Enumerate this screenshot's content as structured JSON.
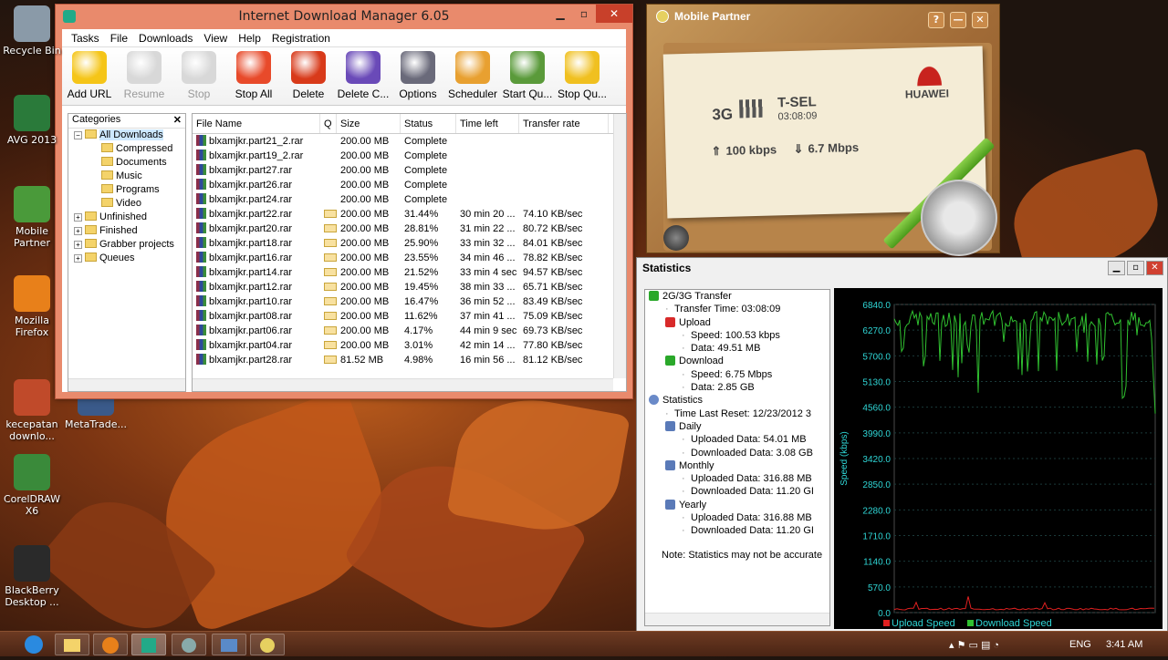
{
  "desktop": {
    "icons": [
      {
        "label": "Recycle Bin",
        "top": 6
      },
      {
        "label": "AVG 2013",
        "top": 104
      },
      {
        "label": "Mobile Partner",
        "top": 204
      },
      {
        "label": "Mozilla Firefox",
        "top": 302
      },
      {
        "label": "kecepatan downlo...",
        "top": 416
      },
      {
        "label": "CorelDRAW X6",
        "top": 498
      },
      {
        "label": "BlackBerry Desktop ...",
        "top": 598
      }
    ],
    "extra_icon": "MetaTrade..."
  },
  "idm": {
    "title": "Internet Download Manager 6.05",
    "menu": [
      "Tasks",
      "File",
      "Downloads",
      "View",
      "Help",
      "Registration"
    ],
    "toolbar": [
      {
        "label": "Add URL",
        "color": "#f5c518",
        "enabled": true
      },
      {
        "label": "Resume",
        "color": "#d8d8d8",
        "enabled": false
      },
      {
        "label": "Stop",
        "color": "#d8d8d8",
        "enabled": false
      },
      {
        "label": "Stop All",
        "color": "#e84a2a",
        "enabled": true
      },
      {
        "label": "Delete",
        "color": "#d83a1a",
        "enabled": true
      },
      {
        "label": "Delete C...",
        "color": "#6a4ab8",
        "enabled": true
      },
      {
        "label": "Options",
        "color": "#6a6a7a",
        "enabled": true
      },
      {
        "label": "Scheduler",
        "color": "#e8a030",
        "enabled": true
      },
      {
        "label": "Start Qu...",
        "color": "#5a9a3a",
        "enabled": true
      },
      {
        "label": "Stop Qu...",
        "color": "#f0c020",
        "enabled": true
      }
    ],
    "categories": {
      "header": "Categories",
      "items": [
        {
          "label": "All Downloads",
          "indent": 1,
          "selected": true
        },
        {
          "label": "Compressed",
          "indent": 2
        },
        {
          "label": "Documents",
          "indent": 2
        },
        {
          "label": "Music",
          "indent": 2
        },
        {
          "label": "Programs",
          "indent": 2
        },
        {
          "label": "Video",
          "indent": 2
        },
        {
          "label": "Unfinished",
          "indent": 1
        },
        {
          "label": "Finished",
          "indent": 1
        },
        {
          "label": "Grabber projects",
          "indent": 1
        },
        {
          "label": "Queues",
          "indent": 1
        }
      ]
    },
    "columns": [
      "File Name",
      "Q",
      "Size",
      "Status",
      "Time left",
      "Transfer rate"
    ],
    "rows": [
      [
        "blxamjkr.part21_2.rar",
        false,
        "200.00 MB",
        "Complete",
        "",
        ""
      ],
      [
        "blxamjkr.part19_2.rar",
        false,
        "200.00 MB",
        "Complete",
        "",
        ""
      ],
      [
        "blxamjkr.part27.rar",
        false,
        "200.00 MB",
        "Complete",
        "",
        ""
      ],
      [
        "blxamjkr.part26.rar",
        false,
        "200.00 MB",
        "Complete",
        "",
        ""
      ],
      [
        "blxamjkr.part24.rar",
        false,
        "200.00 MB",
        "Complete",
        "",
        ""
      ],
      [
        "blxamjkr.part22.rar",
        true,
        "200.00 MB",
        "31.44%",
        "30 min 20 ...",
        "74.10 KB/sec"
      ],
      [
        "blxamjkr.part20.rar",
        true,
        "200.00 MB",
        "28.81%",
        "31 min 22 ...",
        "80.72 KB/sec"
      ],
      [
        "blxamjkr.part18.rar",
        true,
        "200.00 MB",
        "25.90%",
        "33 min 32 ...",
        "84.01 KB/sec"
      ],
      [
        "blxamjkr.part16.rar",
        true,
        "200.00 MB",
        "23.55%",
        "34 min 46 ...",
        "78.82 KB/sec"
      ],
      [
        "blxamjkr.part14.rar",
        true,
        "200.00 MB",
        "21.52%",
        "33 min 4 sec",
        "94.57 KB/sec"
      ],
      [
        "blxamjkr.part12.rar",
        true,
        "200.00 MB",
        "19.45%",
        "38 min 33 ...",
        "65.71 KB/sec"
      ],
      [
        "blxamjkr.part10.rar",
        true,
        "200.00 MB",
        "16.47%",
        "36 min 52 ...",
        "83.49 KB/sec"
      ],
      [
        "blxamjkr.part08.rar",
        true,
        "200.00 MB",
        "11.62%",
        "37 min 41 ...",
        "75.09 KB/sec"
      ],
      [
        "blxamjkr.part06.rar",
        true,
        "200.00 MB",
        "4.17%",
        "44 min 9 sec",
        "69.73 KB/sec"
      ],
      [
        "blxamjkr.part04.rar",
        true,
        "200.00 MB",
        "3.01%",
        "42 min 14 ...",
        "77.80 KB/sec"
      ],
      [
        "blxamjkr.part28.rar",
        true,
        "81.52  MB",
        "4.98%",
        "16 min 56 ...",
        "81.12 KB/sec"
      ]
    ]
  },
  "mobile_partner": {
    "title": "Mobile Partner",
    "network_type": "3G",
    "operator": "T-SEL",
    "connected_time": "03:08:09",
    "upload": "100 kbps",
    "download": "6.7 Mbps",
    "brand": "HUAWEI",
    "buttons": [
      "?",
      "—",
      "✕"
    ]
  },
  "statistics": {
    "title": "Statistics",
    "tree": [
      {
        "text": "2G/3G Transfer",
        "level": 0,
        "icon": "green"
      },
      {
        "text": "Transfer Time: 03:08:09",
        "level": 1
      },
      {
        "text": "Upload",
        "level": 1,
        "icon": "red"
      },
      {
        "text": "Speed: 100.53 kbps",
        "level": 2
      },
      {
        "text": "Data: 49.51 MB",
        "level": 2
      },
      {
        "text": "Download",
        "level": 1,
        "icon": "green"
      },
      {
        "text": "Speed: 6.75 Mbps",
        "level": 2
      },
      {
        "text": "Data: 2.85 GB",
        "level": 2
      },
      {
        "text": "Statistics",
        "level": 0,
        "icon": "clock"
      },
      {
        "text": "Time Last Reset: 12/23/2012 3",
        "level": 1
      },
      {
        "text": "Daily",
        "level": 1,
        "icon": "bars"
      },
      {
        "text": "Uploaded Data: 54.01 MB",
        "level": 2
      },
      {
        "text": "Downloaded Data: 3.08 GB",
        "level": 2
      },
      {
        "text": "Monthly",
        "level": 1,
        "icon": "bars"
      },
      {
        "text": "Uploaded Data: 316.88 MB",
        "level": 2
      },
      {
        "text": "Downloaded Data: 11.20 GI",
        "level": 2
      },
      {
        "text": "Yearly",
        "level": 1,
        "icon": "bars"
      },
      {
        "text": "Uploaded Data: 316.88 MB",
        "level": 2
      },
      {
        "text": "Downloaded Data: 11.20 GI",
        "level": 2
      }
    ],
    "note": "Note: Statistics may not be accurate",
    "graph": {
      "ylabel": "Speed (kbps)",
      "yticks": [
        "6840.0",
        "6270.0",
        "5700.0",
        "5130.0",
        "4560.0",
        "3990.0",
        "3420.0",
        "2850.0",
        "2280.0",
        "1710.0",
        "1140.0",
        "570.0",
        "0.0"
      ],
      "ymax": 6840,
      "legend": [
        {
          "name": "Upload Speed",
          "color": "#e02020"
        },
        {
          "name": "Download Speed",
          "color": "#30c030"
        }
      ]
    }
  },
  "taskbar": {
    "lang": "ENG",
    "time": "3:41 AM"
  }
}
